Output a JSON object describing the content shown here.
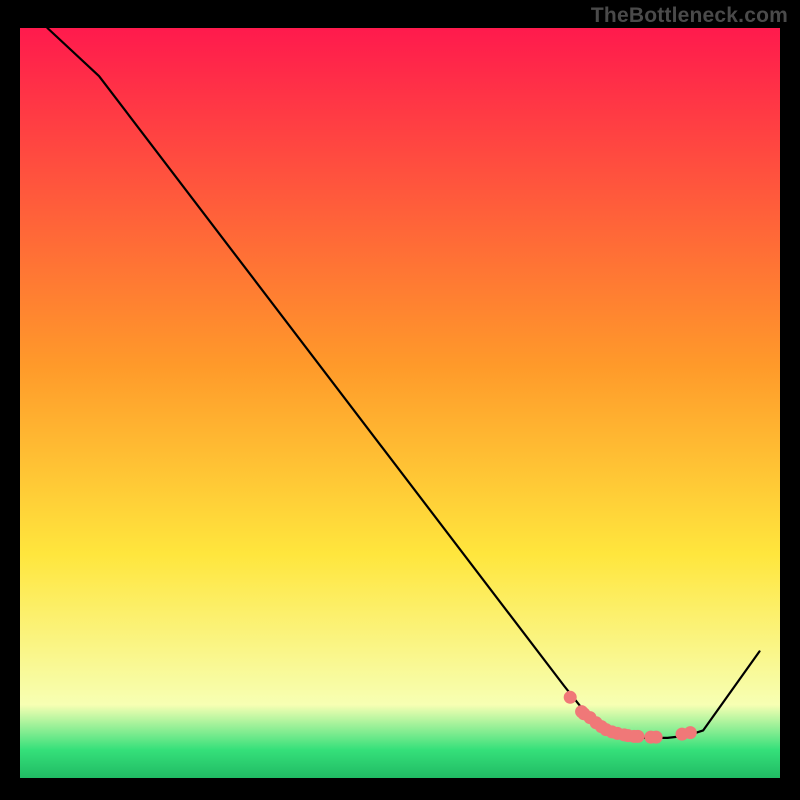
{
  "watermark": "TheBottleneck.com",
  "colors": {
    "background": "#000000",
    "curve_stroke": "#000000",
    "marker_fill": "#f07878",
    "gradient_stop_top": "#ff1a4d",
    "gradient_stop_mid1": "#ff8a2a",
    "gradient_stop_mid2": "#ffe63d",
    "gradient_stop_low": "#f7ffb3",
    "gradient_stop_green": "#35e07a"
  },
  "chart_data": {
    "type": "line",
    "title": "",
    "xlabel": "",
    "ylabel": "",
    "xlim": [
      0,
      100
    ],
    "ylim": [
      0,
      100
    ],
    "grid": false,
    "legend": false,
    "series": [
      {
        "name": "bottleneck-curve",
        "x": [
          3.6,
          10.4,
          71.6,
          75.3,
          79.5,
          82.1,
          85.2,
          87.8,
          89.9,
          97.3
        ],
        "y": [
          100,
          93.6,
          12.5,
          7.8,
          5.9,
          5.6,
          5.6,
          5.9,
          6.6,
          17.1
        ]
      }
    ],
    "markers": {
      "name": "bottleneck-flat-points",
      "x": [
        72.4,
        73.9,
        74.2,
        75.0,
        75.8,
        76.5,
        77.1,
        77.9,
        78.6,
        79.5,
        80.0,
        80.8,
        81.3,
        83.0,
        83.7,
        87.1,
        88.2
      ],
      "y": [
        11.0,
        9.1,
        8.8,
        8.3,
        7.6,
        7.1,
        6.7,
        6.4,
        6.2,
        6.0,
        5.9,
        5.8,
        5.8,
        5.7,
        5.7,
        6.1,
        6.3
      ]
    }
  }
}
